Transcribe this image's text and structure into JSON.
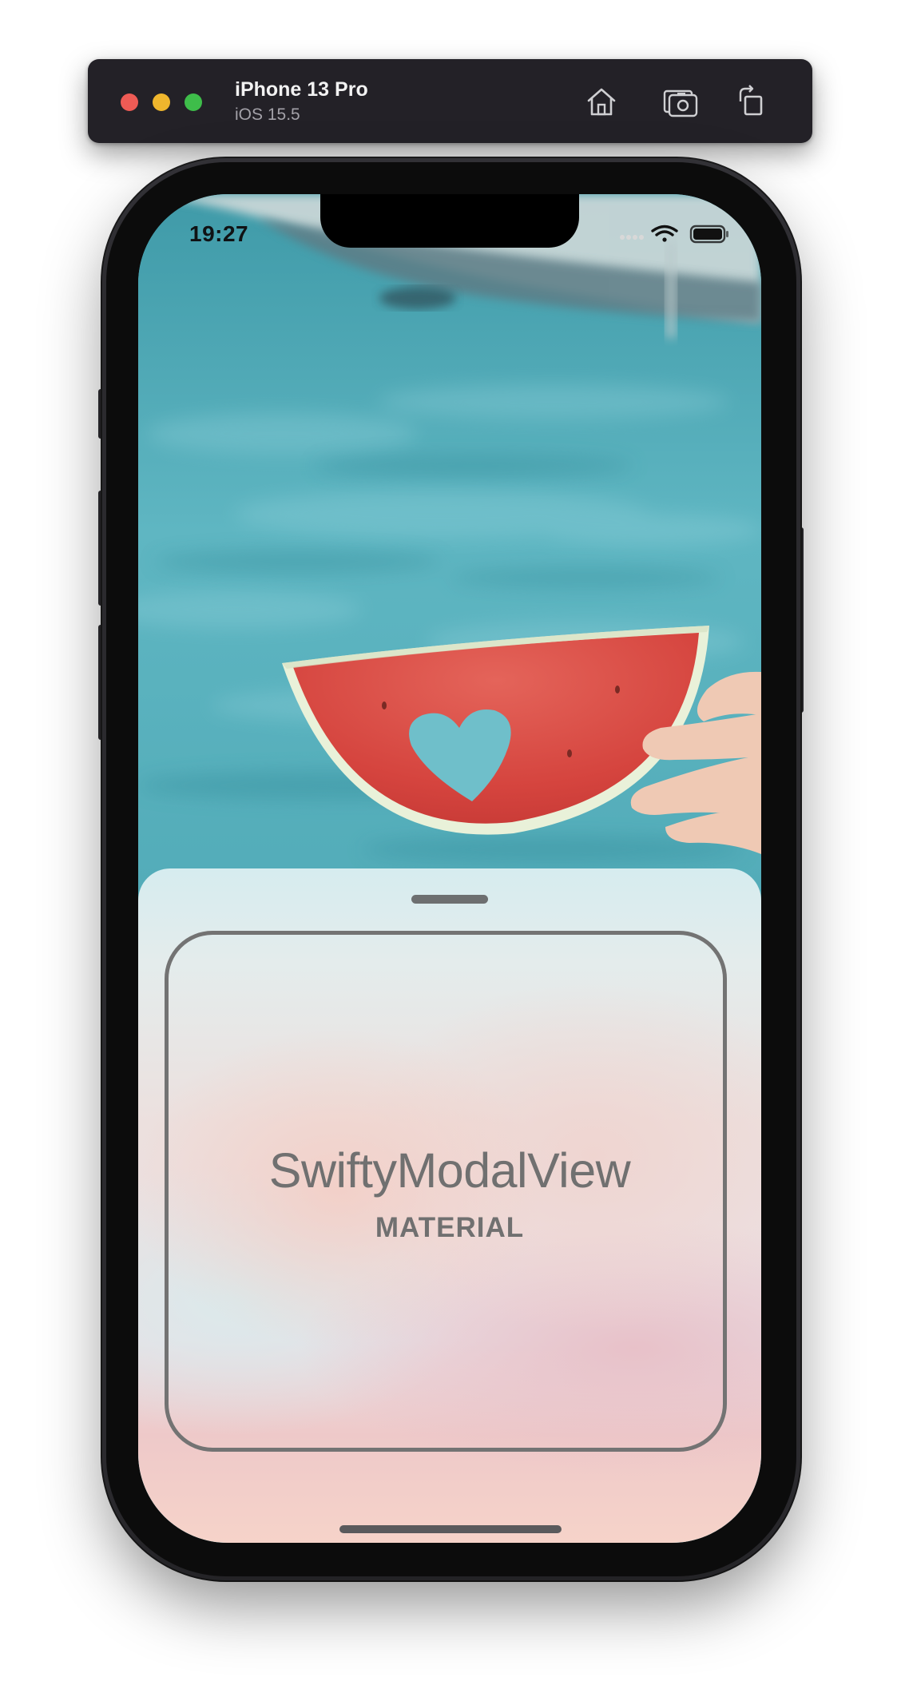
{
  "simulator": {
    "device_name": "iPhone 13 Pro",
    "os_version": "iOS 15.5",
    "buttons": [
      {
        "icon": "home-icon",
        "label": "Home"
      },
      {
        "icon": "screenshot-icon",
        "label": "Screenshot"
      },
      {
        "icon": "rotate-icon",
        "label": "Rotate"
      }
    ],
    "window_controls": [
      "close",
      "minimize",
      "zoom"
    ]
  },
  "status_bar": {
    "time": "19:27",
    "icons": [
      "cellular-icon",
      "wifi-icon",
      "battery-icon"
    ]
  },
  "background_photo": {
    "subject": "watermelon-slice-with-heart-over-pool"
  },
  "modal": {
    "title": "SwiftyModalView",
    "subtitle": "MATERIAL"
  },
  "colors": {
    "sim_bar": "#232127",
    "traffic_red": "#ee5b55",
    "traffic_yellow": "#efb62d",
    "traffic_green": "#3ebd4a",
    "pool": "#4ba9b6",
    "watermelon": "#d94f47",
    "card_border": "#737373",
    "text_gray": "#707070"
  }
}
